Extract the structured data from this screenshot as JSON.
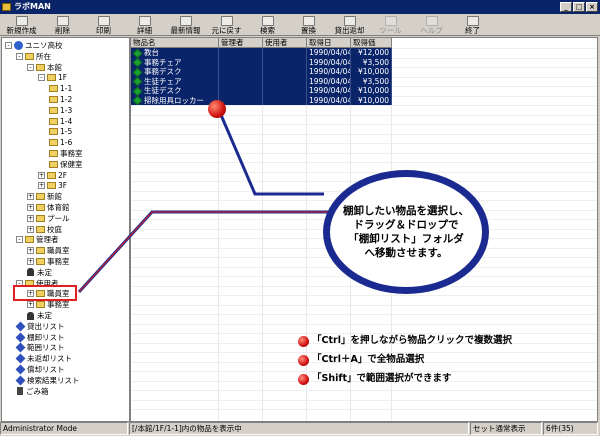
{
  "window": {
    "title": "ラボMAN",
    "buttons": [
      "_",
      "□",
      "×"
    ]
  },
  "toolbar": [
    {
      "label": "新規作成",
      "icon": "new-icon",
      "enabled": true
    },
    {
      "label": "削除",
      "icon": "delete-icon",
      "enabled": true
    },
    {
      "label": "印刷",
      "icon": "print-icon",
      "enabled": true
    },
    {
      "label": "詳細",
      "icon": "detail-icon",
      "enabled": true
    },
    {
      "label": "最新情報",
      "icon": "refresh-icon",
      "enabled": true
    },
    {
      "label": "元に戻す",
      "icon": "undo-icon",
      "enabled": true
    },
    {
      "label": "検索",
      "icon": "search-icon",
      "enabled": true
    },
    {
      "label": "置換",
      "icon": "replace-icon",
      "enabled": true
    },
    {
      "label": "貸出返却",
      "icon": "lend-icon",
      "enabled": true
    },
    {
      "label": "ツール",
      "icon": "tool-icon",
      "enabled": false
    },
    {
      "label": "ヘルプ",
      "icon": "help-icon",
      "enabled": false
    },
    {
      "label": "終了",
      "icon": "exit-icon",
      "enabled": true
    }
  ],
  "tree": [
    {
      "label": "ユニソ高校",
      "icon": "globe",
      "exp": "-",
      "lvl": 0
    },
    {
      "label": "所在",
      "icon": "folder",
      "exp": "-",
      "lvl": 1
    },
    {
      "label": "本館",
      "icon": "folder",
      "exp": "-",
      "lvl": 2
    },
    {
      "label": "1F",
      "icon": "folder",
      "exp": "-",
      "lvl": 3
    },
    {
      "label": "1-1",
      "icon": "folder",
      "exp": "",
      "lvl": 4
    },
    {
      "label": "1-2",
      "icon": "folder",
      "exp": "",
      "lvl": 4
    },
    {
      "label": "1-3",
      "icon": "folder",
      "exp": "",
      "lvl": 4
    },
    {
      "label": "1-4",
      "icon": "folder",
      "exp": "",
      "lvl": 4
    },
    {
      "label": "1-5",
      "icon": "folder",
      "exp": "",
      "lvl": 4
    },
    {
      "label": "1-6",
      "icon": "folder",
      "exp": "",
      "lvl": 4
    },
    {
      "label": "事務室",
      "icon": "folder",
      "exp": "",
      "lvl": 4
    },
    {
      "label": "保健室",
      "icon": "folder",
      "exp": "",
      "lvl": 4
    },
    {
      "label": "2F",
      "icon": "folder",
      "exp": "+",
      "lvl": 3
    },
    {
      "label": "3F",
      "icon": "folder",
      "exp": "+",
      "lvl": 3
    },
    {
      "label": "新館",
      "icon": "folder",
      "exp": "+",
      "lvl": 2
    },
    {
      "label": "体育館",
      "icon": "folder",
      "exp": "+",
      "lvl": 2
    },
    {
      "label": "プール",
      "icon": "folder",
      "exp": "+",
      "lvl": 2
    },
    {
      "label": "校庭",
      "icon": "folder",
      "exp": "+",
      "lvl": 2
    },
    {
      "label": "管理者",
      "icon": "folder",
      "exp": "-",
      "lvl": 1
    },
    {
      "label": "職員室",
      "icon": "folder",
      "exp": "+",
      "lvl": 2
    },
    {
      "label": "事務室",
      "icon": "folder",
      "exp": "+",
      "lvl": 2
    },
    {
      "label": "未定",
      "icon": "person",
      "exp": "",
      "lvl": 2
    },
    {
      "label": "使用者",
      "icon": "folder",
      "exp": "-",
      "lvl": 1
    },
    {
      "label": "職員室",
      "icon": "folder",
      "exp": "+",
      "lvl": 2
    },
    {
      "label": "事務室",
      "icon": "folder",
      "exp": "+",
      "lvl": 2
    },
    {
      "label": "未定",
      "icon": "person",
      "exp": "",
      "lvl": 2
    },
    {
      "label": "貸出リスト",
      "icon": "pin",
      "exp": "",
      "lvl": 1
    },
    {
      "label": "棚卸リスト",
      "icon": "pin",
      "exp": "",
      "lvl": 1
    },
    {
      "label": "範囲リスト",
      "icon": "pin",
      "exp": "",
      "lvl": 1
    },
    {
      "label": "未返却リスト",
      "icon": "pin",
      "exp": "",
      "lvl": 1
    },
    {
      "label": "償却リスト",
      "icon": "pin",
      "exp": "",
      "lvl": 1
    },
    {
      "label": "検索結果リスト",
      "icon": "pin",
      "exp": "",
      "lvl": 1
    },
    {
      "label": "ごみ箱",
      "icon": "trash",
      "exp": "",
      "lvl": 1
    }
  ],
  "columns": [
    "物品名",
    "管理者",
    "使用者",
    "取得日",
    "取得価"
  ],
  "rows": [
    [
      "教台",
      "",
      "",
      "1990/04/04",
      "¥12,000"
    ],
    [
      "事務チェア",
      "",
      "",
      "1990/04/04",
      "¥3,500"
    ],
    [
      "事務デスク",
      "",
      "",
      "1990/04/04",
      "¥10,000"
    ],
    [
      "生徒チェア",
      "",
      "",
      "1990/04/04",
      "¥3,500"
    ],
    [
      "生徒デスク",
      "",
      "",
      "1990/04/04",
      "¥10,000"
    ],
    [
      "掃除用具ロッカー",
      "",
      "",
      "1990/04/04",
      "¥10,000"
    ]
  ],
  "callout": {
    "lines": [
      "棚卸したい物品を選択し、",
      "ドラッグ＆ドロップで",
      "「棚卸リスト」フォルダ",
      "へ移動させます。"
    ]
  },
  "notes": [
    "「Ctrl」を押しながら物品クリックで複数選択",
    "「Ctrl＋A」で全物品選択",
    "「Shift」で範囲選択ができます"
  ],
  "status": {
    "mode": "Administrator Mode",
    "path": "[/本館/1F/1-1]内の物品を表示中",
    "button": "セット通常表示",
    "count": "6件(35)"
  },
  "colors": {
    "accent": "#1a2a90",
    "selection": "#0a246a",
    "highlight": "#e02020",
    "bullet": "#d01010"
  }
}
